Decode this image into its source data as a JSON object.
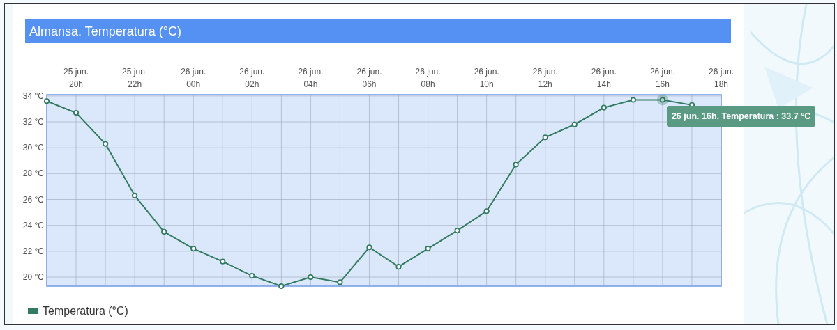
{
  "chart_data": {
    "type": "line",
    "title": "Almansa. Temperatura (°C)",
    "grid": true,
    "categories": [
      null,
      "25 jun. 20h",
      null,
      "25 jun. 22h",
      null,
      "26 jun. 00h",
      null,
      "26 jun. 02h",
      null,
      "26 jun. 04h",
      null,
      "26 jun. 06h",
      null,
      "26 jun. 08h",
      null,
      "26 jun. 10h",
      null,
      "26 jun. 12h",
      null,
      "26 jun. 14h",
      null,
      "26 jun. 16h",
      null,
      "26 jun. 18h"
    ],
    "series": [
      {
        "name": "Temperatura (°C)",
        "color": "#327a60",
        "marker": "circle",
        "values": [
          33.6,
          32.7,
          30.3,
          26.3,
          23.5,
          22.2,
          21.2,
          20.1,
          19.3,
          20.0,
          19.6,
          22.3,
          20.8,
          22.2,
          23.6,
          25.1,
          28.7,
          30.8,
          31.8,
          33.1,
          33.7,
          33.7,
          33.3,
          null
        ]
      }
    ],
    "ylim": [
      19.3,
      34.1
    ],
    "yticks": [
      {
        "value": 20,
        "label": "20 °C"
      },
      {
        "value": 22,
        "label": "22 °C"
      },
      {
        "value": 24,
        "label": "24 °C"
      },
      {
        "value": 26,
        "label": "26 °C"
      },
      {
        "value": 28,
        "label": "28 °C"
      },
      {
        "value": 30,
        "label": "30 °C"
      },
      {
        "value": 32,
        "label": "32 °C"
      },
      {
        "value": 34,
        "label": "34 °C"
      }
    ],
    "annotations": [
      {
        "x": "26 jun. 16h",
        "y": 33.7,
        "text": "26 jun. 16h, Temperatura : 33.7 °C"
      }
    ]
  }
}
